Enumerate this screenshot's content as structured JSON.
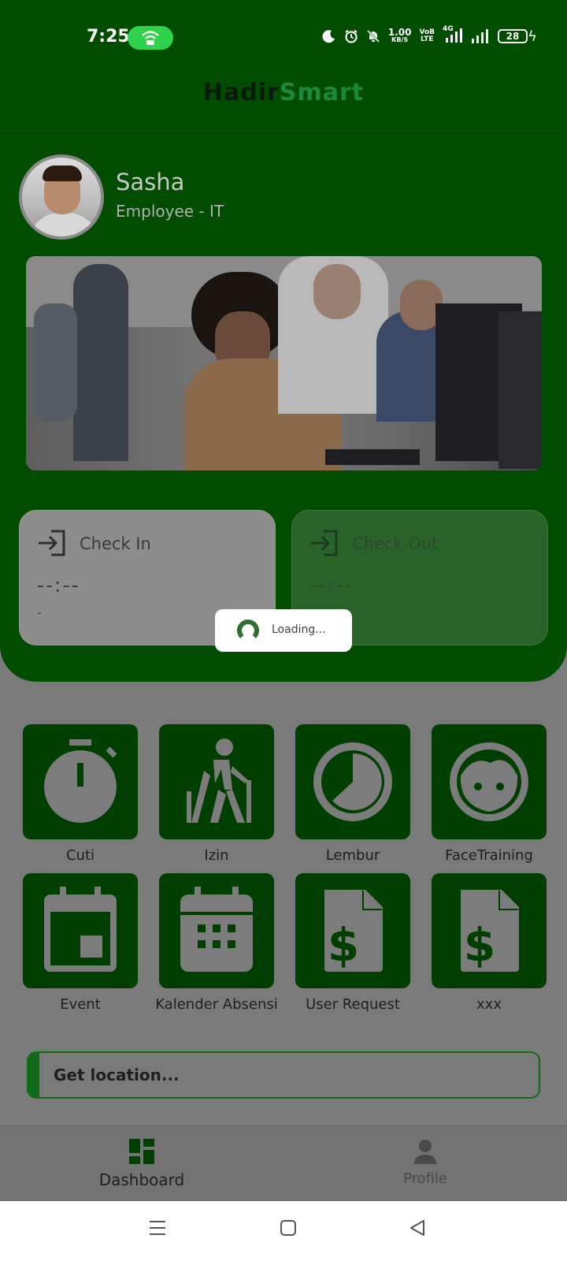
{
  "status_bar": {
    "time": "7:25",
    "net_speed_value": "1.00",
    "net_speed_unit": "KB/S",
    "volte_top": "VoB",
    "volte_bottom": "LTE",
    "signal_label": "4G",
    "battery": "28"
  },
  "app": {
    "brand_part1": "Hadir",
    "brand_part2": "Smart"
  },
  "user": {
    "name": "Sasha",
    "role": "Employee - IT"
  },
  "attendance": {
    "check_in": {
      "label": "Check In",
      "time": "--:--",
      "note": "-"
    },
    "check_out": {
      "label": "Check Out",
      "time": "--:--"
    }
  },
  "loading": {
    "text": "Loading..."
  },
  "menu": [
    {
      "label": "Cuti",
      "icon": "stopwatch-icon"
    },
    {
      "label": "Izin",
      "icon": "walking-person-icon"
    },
    {
      "label": "Lembur",
      "icon": "clock-icon"
    },
    {
      "label": "FaceTraining",
      "icon": "face-icon"
    },
    {
      "label": "Event",
      "icon": "calendar-event-icon"
    },
    {
      "label": "Kalender Absensi",
      "icon": "calendar-grid-icon"
    },
    {
      "label": "User Request",
      "icon": "dollar-document-icon"
    },
    {
      "label": "xxx",
      "icon": "dollar-document-icon"
    }
  ],
  "location": {
    "text": "Get location..."
  },
  "bottom_nav": {
    "dashboard": "Dashboard",
    "profile": "Profile"
  },
  "colors": {
    "primary": "#004d00",
    "tile": "#003f00",
    "accent": "#0f6a1a",
    "overlay_gray": "#7a7a7a"
  }
}
